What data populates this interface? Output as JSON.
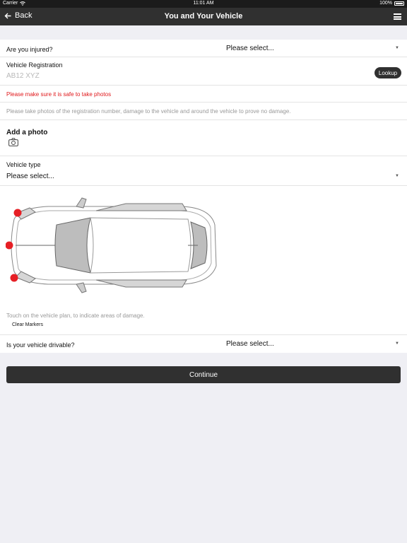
{
  "status_bar": {
    "carrier": "Carrier",
    "time": "11:01 AM",
    "battery": "100%"
  },
  "nav": {
    "back_label": "Back",
    "title": "You and Your Vehicle"
  },
  "injured": {
    "label": "Are you injured?",
    "value": "Please select..."
  },
  "registration": {
    "label": "Vehicle Registration",
    "placeholder": "AB12 XYZ",
    "lookup_label": "Lookup"
  },
  "warning": "Please make sure it is safe to take photos",
  "photo_instructions": "Please take photos of the registration number, damage to the vehicle and around the vehicle to prove no damage.",
  "add_photo": {
    "title": "Add a photo"
  },
  "vehicle_type": {
    "label": "Vehicle type",
    "value": "Please select..."
  },
  "damage_plan": {
    "hint": "Touch on the vehicle plan, to indicate areas of damage.",
    "clear_label": "Clear Markers",
    "marker_color": "#e61f25",
    "marker_count": 3
  },
  "drivable": {
    "label": "Is your vehicle drivable?",
    "value": "Please select..."
  },
  "continue_label": "Continue",
  "colors": {
    "nav": "#303030",
    "warning": "#e0181b",
    "background": "#efeff4"
  }
}
